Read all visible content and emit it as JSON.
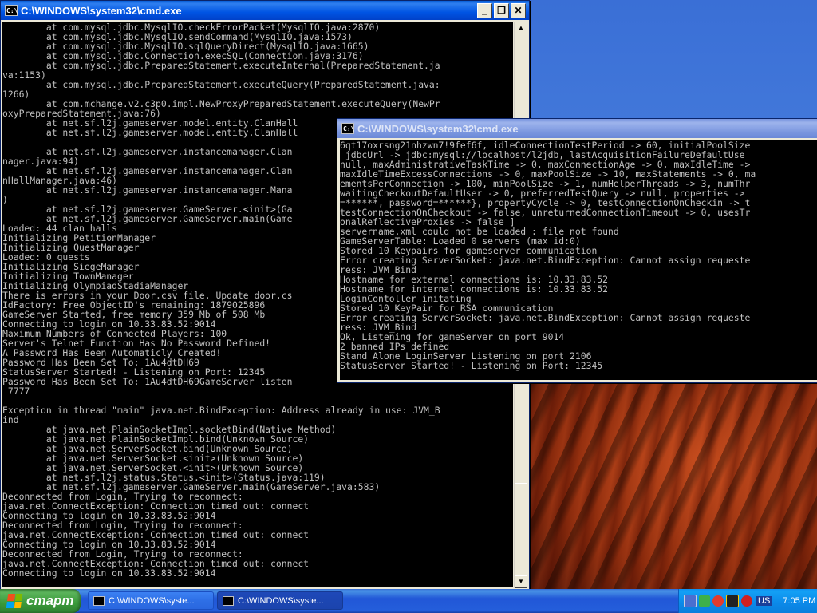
{
  "window1": {
    "title": "C:\\WINDOWS\\system32\\cmd.exe",
    "lines": [
      "        at com.mysql.jdbc.MysqlIO.checkErrorPacket(MysqlIO.java:2870)",
      "        at com.mysql.jdbc.MysqlIO.sendCommand(MysqlIO.java:1573)",
      "        at com.mysql.jdbc.MysqlIO.sqlQueryDirect(MysqlIO.java:1665)",
      "        at com.mysql.jdbc.Connection.execSQL(Connection.java:3176)",
      "        at com.mysql.jdbc.PreparedStatement.executeInternal(PreparedStatement.ja",
      "va:1153)",
      "        at com.mysql.jdbc.PreparedStatement.executeQuery(PreparedStatement.java:",
      "1266)",
      "        at com.mchange.v2.c3p0.impl.NewProxyPreparedStatement.executeQuery(NewPr",
      "oxyPreparedStatement.java:76)",
      "        at net.sf.l2j.gameserver.model.entity.ClanHall",
      "        at net.sf.l2j.gameserver.model.entity.ClanHall",
      "",
      "        at net.sf.l2j.gameserver.instancemanager.Clan",
      "nager.java:94)",
      "        at net.sf.l2j.gameserver.instancemanager.Clan",
      "nHallManager.java:46)",
      "        at net.sf.l2j.gameserver.instancemanager.Mana",
      ")",
      "        at net.sf.l2j.gameserver.GameServer.<init>(Ga",
      "        at net.sf.l2j.gameserver.GameServer.main(Game",
      "Loaded: 44 clan halls",
      "Initializing PetitionManager",
      "Initializing QuestManager",
      "Loaded: 0 quests",
      "Initializing SiegeManager",
      "Initializing TownManager",
      "Initializing OlympiadStadiaManager",
      "There is errors in your Door.csv file. Update door.cs",
      "IdFactory: Free ObjectID's remaining: 1879025896",
      "GameServer Started, free memory 359 Mb of 508 Mb",
      "Connecting to login on 10.33.83.52:9014",
      "Maximum Numbers of Connected Players: 100",
      "Server's Telnet Function Has No Password Defined!",
      "A Password Has Been Automaticly Created!",
      "Password Has Been Set To: 1Au4dtDH69",
      "StatusServer Started! - Listening on Port: 12345",
      "Password Has Been Set To: 1Au4dtDH69GameServer listen",
      " 7777",
      "",
      "Exception in thread \"main\" java.net.BindException: Address already in use: JVM_B",
      "ind",
      "        at java.net.PlainSocketImpl.socketBind(Native Method)",
      "        at java.net.PlainSocketImpl.bind(Unknown Source)",
      "        at java.net.ServerSocket.bind(Unknown Source)",
      "        at java.net.ServerSocket.<init>(Unknown Source)",
      "        at java.net.ServerSocket.<init>(Unknown Source)",
      "        at net.sf.l2j.status.Status.<init>(Status.java:119)",
      "        at net.sf.l2j.gameserver.GameServer.main(GameServer.java:583)",
      "Deconnected from Login, Trying to reconnect:",
      "java.net.ConnectException: Connection timed out: connect",
      "Connecting to login on 10.33.83.52:9014",
      "Deconnected from Login, Trying to reconnect:",
      "java.net.ConnectException: Connection timed out: connect",
      "Connecting to login on 10.33.83.52:9014",
      "Deconnected from Login, Trying to reconnect:",
      "java.net.ConnectException: Connection timed out: connect",
      "Connecting to login on 10.33.83.52:9014"
    ]
  },
  "window2": {
    "title": "C:\\WINDOWS\\system32\\cmd.exe",
    "lines": [
      "6qt17oxrsng21nhzwn7!9fef6f, idleConnectionTestPeriod -> 60, initialPoolSize",
      " jdbcUrl -> jdbc:mysql://localhost/l2jdb, lastAcquisitionFailureDefaultUse",
      "null, maxAdministrativeTaskTime -> 0, maxConnectionAge -> 0, maxIdleTime ->",
      "maxIdleTimeExcessConnections -> 0, maxPoolSize -> 10, maxStatements -> 0, ma",
      "ementsPerConnection -> 100, minPoolSize -> 1, numHelperThreads -> 3, numThr",
      "waitingCheckoutDefaultUser -> 0, preferredTestQuery -> null, properties ->",
      "=******, password=******}, propertyCycle -> 0, testConnectionOnCheckin -> t",
      "testConnectionOnCheckout -> false, unreturnedConnectionTimeout -> 0, usesTr",
      "onalReflectiveProxies -> false ]",
      "servername.xml could not be loaded : file not found",
      "GameServerTable: Loaded 0 servers (max id:0)",
      "Stored 10 Keypairs for gameserver communication",
      "Error creating ServerSocket: java.net.BindException: Cannot assign requeste",
      "ress: JVM_Bind",
      "Hostname for external connections is: 10.33.83.52",
      "Hostname for internal connections is: 10.33.83.52",
      "LoginContoller initating",
      "Stored 10 KeyPair for RSA communication",
      "Error creating ServerSocket: java.net.BindException: Cannot assign requeste",
      "ress: JVM_Bind",
      "Ok, Listening for gameServer on port 9014",
      "2 banned IPs defined",
      "Stand Alone LoginServer Listening on port 2106",
      "StatusServer Started! - Listening on Port: 12345"
    ]
  },
  "taskbar": {
    "start_label": "старт",
    "tasks": [
      {
        "label": "C:\\WINDOWS\\syste..."
      },
      {
        "label": "C:\\WINDOWS\\syste..."
      }
    ],
    "language": "US",
    "clock": "7:05 PM"
  },
  "colors": {
    "console_bg": "#000000",
    "console_fg": "#c0c0c0",
    "titlebar_active": "#0054e3",
    "titlebar_inactive": "#7a96df",
    "desktop": "#3a6fd6"
  },
  "icons": [
    "cmd-icon",
    "minimize-icon",
    "maximize-icon",
    "close-icon",
    "scroll-up-icon",
    "scroll-down-icon",
    "windows-logo-icon"
  ]
}
